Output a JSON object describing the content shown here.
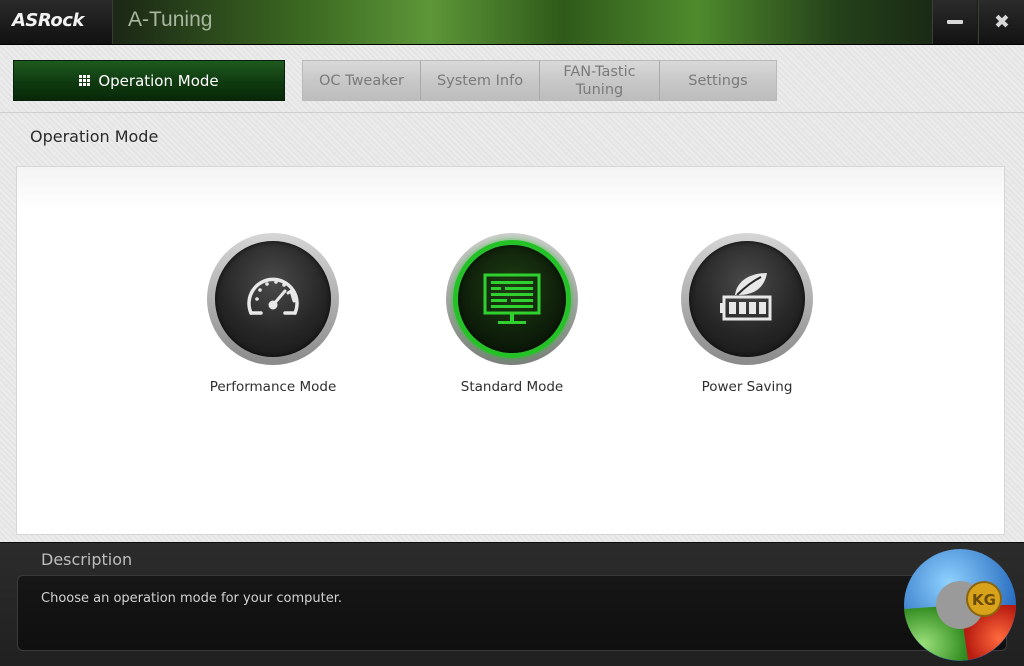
{
  "window": {
    "brand": "ASRock",
    "title": "A-Tuning",
    "minimize_icon": "minimize-icon",
    "close_icon": "close-icon"
  },
  "tabs": {
    "active": {
      "label": "Operation Mode",
      "icon": "grid-icon"
    },
    "items": [
      {
        "label": "OC Tweaker"
      },
      {
        "label": "System Info"
      },
      {
        "label": "FAN-Tastic Tuning"
      },
      {
        "label": "Settings"
      }
    ]
  },
  "section": {
    "title": "Operation Mode"
  },
  "modes": [
    {
      "label": "Performance Mode",
      "icon": "speedometer-icon",
      "selected": false
    },
    {
      "label": "Standard Mode",
      "icon": "monitor-icon",
      "selected": true
    },
    {
      "label": "Power Saving",
      "icon": "leaf-battery-icon",
      "selected": false
    }
  ],
  "description": {
    "title": "Description",
    "text": "Choose an operation mode for your computer."
  },
  "watermark": {
    "text": "KG"
  },
  "colors": {
    "accent_green": "#25c227",
    "active_tab_green": "#0f3a10",
    "title_bar_green": "#5d9638"
  }
}
